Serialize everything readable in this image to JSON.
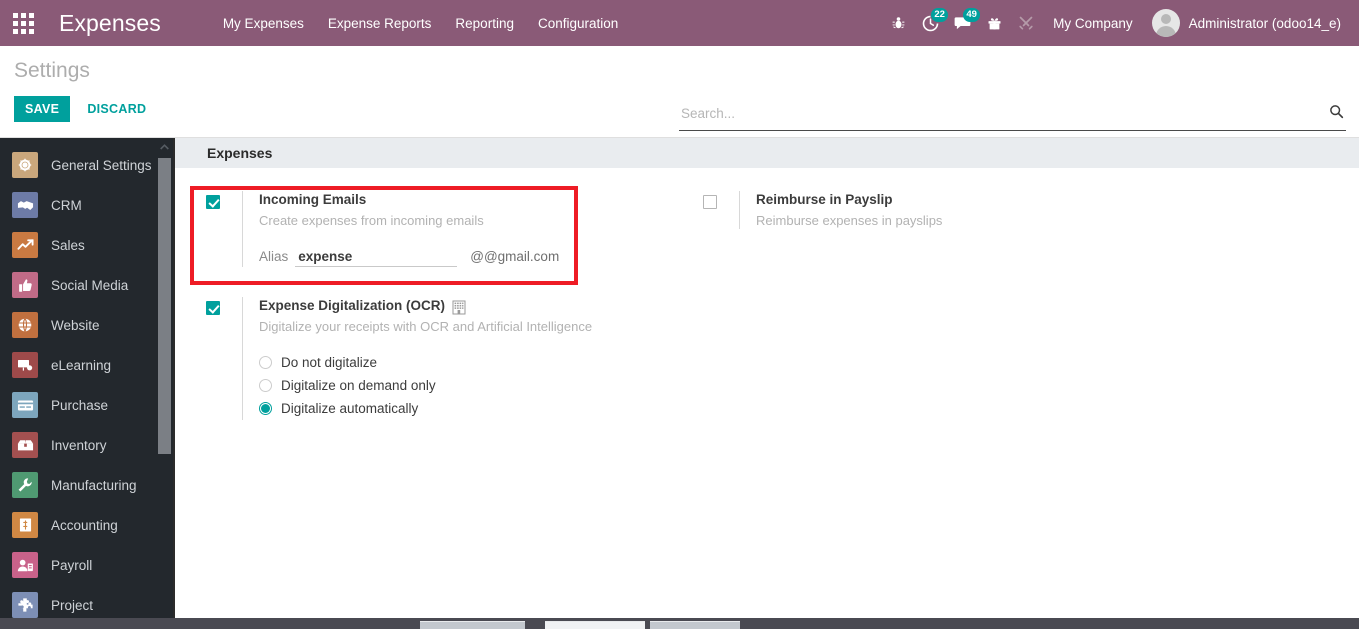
{
  "topbar": {
    "apps_icon": "apps-grid-icon",
    "brand": "Expenses",
    "menu": [
      {
        "label": "My Expenses"
      },
      {
        "label": "Expense Reports"
      },
      {
        "label": "Reporting"
      },
      {
        "label": "Configuration"
      }
    ],
    "sys_icons": [
      {
        "name": "bug-icon",
        "badge": null
      },
      {
        "name": "activity-clock-icon",
        "badge": "22"
      },
      {
        "name": "messages-chat-icon",
        "badge": "49"
      },
      {
        "name": "gift-icon",
        "badge": null
      },
      {
        "name": "tools-icon",
        "badge": null
      }
    ],
    "company": "My Company",
    "user": "Administrator (odoo14_e)",
    "avatar": "user-avatar-icon",
    "bg_color": "#8a5a77"
  },
  "control_panel": {
    "title": "Settings",
    "save_label": "SAVE",
    "discard_label": "DISCARD",
    "accent_color": "#00a09d"
  },
  "search": {
    "placeholder": "Search...",
    "value": "",
    "icon": "search-icon"
  },
  "sidebar": {
    "items": [
      {
        "label": "General Settings",
        "icon": "gear-icon",
        "color": "#c9a77c"
      },
      {
        "label": "CRM",
        "icon": "handshake-icon",
        "color": "#6d7ba6"
      },
      {
        "label": "Sales",
        "icon": "chart-line-icon",
        "color": "#c97a42"
      },
      {
        "label": "Social Media",
        "icon": "thumbs-up-icon",
        "color": "#c06b87"
      },
      {
        "label": "Website",
        "icon": "globe-icon",
        "color": "#c0703f"
      },
      {
        "label": "eLearning",
        "icon": "presentation-icon",
        "color": "#9e4a4a"
      },
      {
        "label": "Purchase",
        "icon": "card-icon",
        "color": "#7da6bd"
      },
      {
        "label": "Inventory",
        "icon": "box-icon",
        "color": "#a35050"
      },
      {
        "label": "Manufacturing",
        "icon": "wrench-icon",
        "color": "#4f9a72"
      },
      {
        "label": "Accounting",
        "icon": "invoice-icon",
        "color": "#d08844"
      },
      {
        "label": "Payroll",
        "icon": "employee-icon",
        "color": "#c9628a"
      },
      {
        "label": "Project",
        "icon": "puzzle-icon",
        "color": "#7d8fb5"
      }
    ],
    "scrollbar": {
      "up_arrow": "chevron-up-icon",
      "down_arrow": "chevron-down-icon"
    }
  },
  "main": {
    "section_title": "Expenses",
    "settings": {
      "incoming_emails": {
        "checked": true,
        "title": "Incoming Emails",
        "description": "Create expenses from incoming emails",
        "alias_label": "Alias",
        "alias_value": "expense",
        "alias_placeholder": "",
        "alias_suffix": "@@gmail.com",
        "highlighted": true
      },
      "reimburse_payslip": {
        "checked": false,
        "title": "Reimburse in Payslip",
        "description": "Reimburse expenses in payslips"
      },
      "expense_digitalization": {
        "checked": true,
        "title": "Expense Digitalization (OCR)",
        "badge_icon": "enterprise-building-icon",
        "description": "Digitalize your receipts with OCR and Artificial Intelligence",
        "options": [
          {
            "label": "Do not digitalize",
            "selected": false
          },
          {
            "label": "Digitalize on demand only",
            "selected": false
          },
          {
            "label": "Digitalize automatically",
            "selected": true
          }
        ]
      }
    }
  },
  "annotation": {
    "highlight_color": "#ee1c25"
  }
}
